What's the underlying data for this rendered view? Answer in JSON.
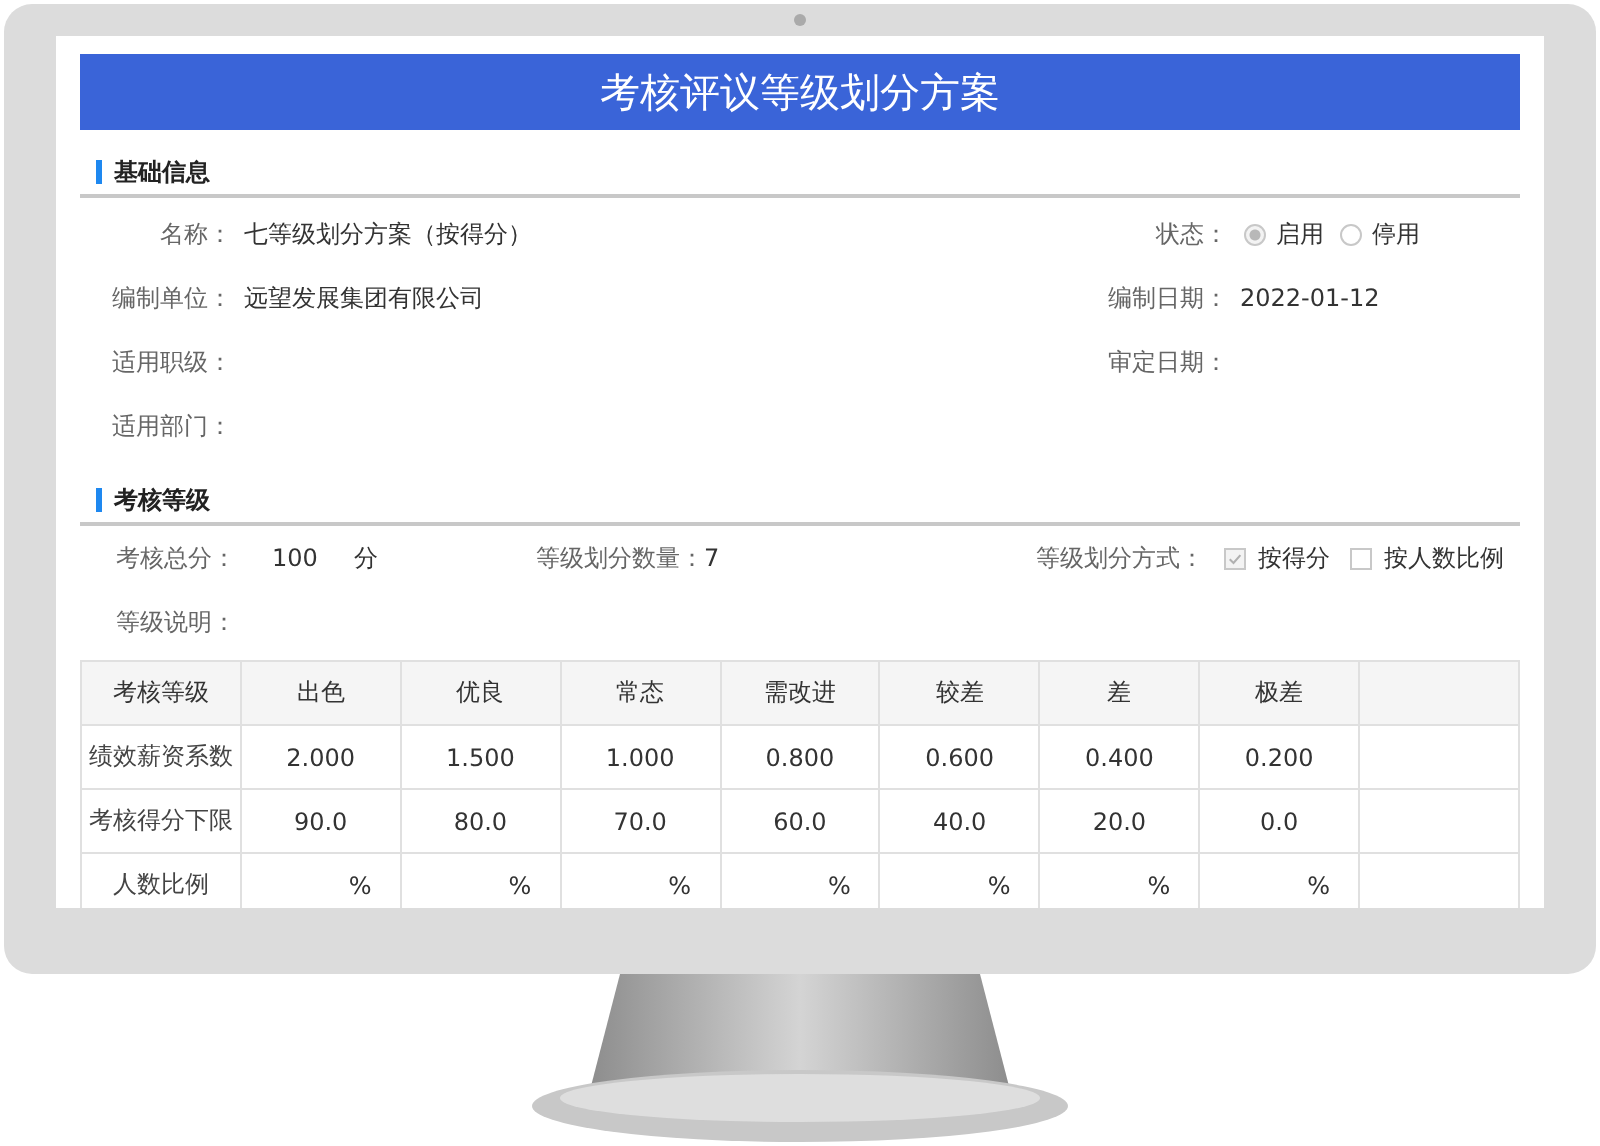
{
  "title": "考核评议等级划分方案",
  "basic_info": {
    "heading": "基础信息",
    "name": {
      "label": "名称：",
      "value": "七等级划分方案（按得分）"
    },
    "status": {
      "label": "状态：",
      "options": [
        {
          "label": "启用",
          "selected": true
        },
        {
          "label": "停用",
          "selected": false
        }
      ]
    },
    "unit": {
      "label": "编制单位：",
      "value": "远望发展集团有限公司"
    },
    "compiled_date": {
      "label": "编制日期：",
      "value": "2022-01-12"
    },
    "grade_scope": {
      "label": "适用职级："
    },
    "approved_date": {
      "label": "审定日期："
    },
    "departments": {
      "label": "适用部门："
    }
  },
  "grading": {
    "heading": "考核等级",
    "total_score": {
      "label": "考核总分：",
      "value": "100",
      "unit": "分"
    },
    "grade_count": {
      "label": "等级划分数量：",
      "value": "7"
    },
    "method": {
      "label": "等级划分方式：",
      "options": [
        {
          "label": "按得分",
          "checked": true
        },
        {
          "label": "按人数比例",
          "checked": false
        }
      ]
    },
    "description": {
      "label": "等级说明："
    }
  },
  "table": {
    "columns": [
      "考核等级",
      "出色",
      "优良",
      "常态",
      "需改进",
      "较差",
      "差",
      "极差"
    ],
    "rows": [
      {
        "kind": "value",
        "cells": [
          "绩效薪资系数",
          "2.000",
          "1.500",
          "1.000",
          "0.800",
          "0.600",
          "0.400",
          "0.200"
        ]
      },
      {
        "kind": "value",
        "cells": [
          "考核得分下限",
          "90.0",
          "80.0",
          "70.0",
          "60.0",
          "40.0",
          "20.0",
          "0.0"
        ]
      },
      {
        "kind": "percent",
        "cells": [
          "人数比例",
          "%",
          "%",
          "%",
          "%",
          "%",
          "%",
          "%"
        ]
      }
    ]
  }
}
